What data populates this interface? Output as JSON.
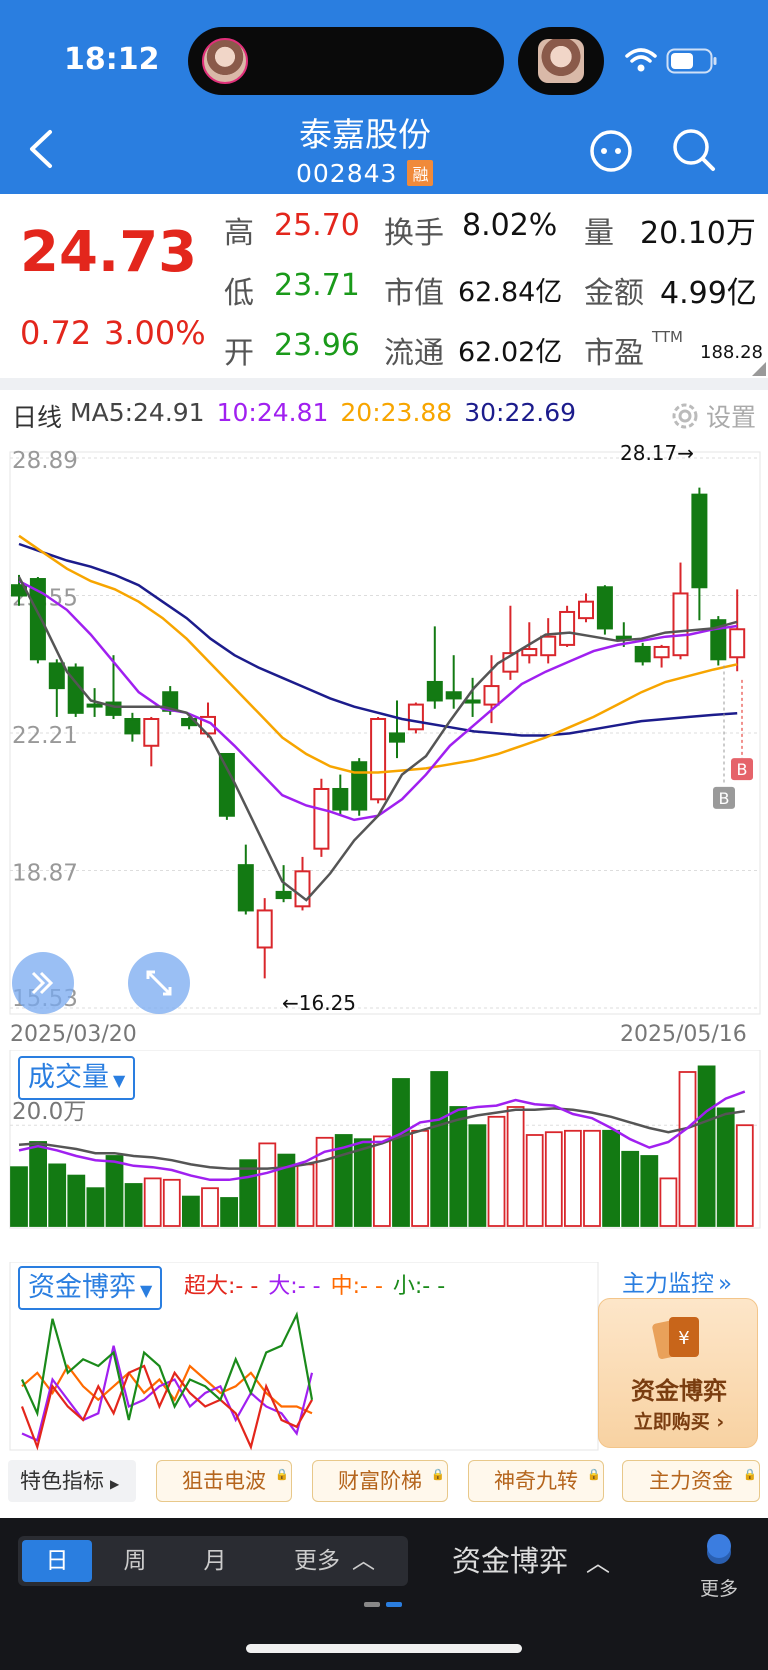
{
  "status_bar": {
    "time": "18:12"
  },
  "header": {
    "title": "泰嘉股份",
    "code": "002843",
    "badge": "融"
  },
  "quote": {
    "price": "24.73",
    "change": "0.72",
    "change_pct": "3.00%",
    "high_label": "高",
    "high": "25.70",
    "low_label": "低",
    "low": "23.71",
    "open_label": "开",
    "open": "23.96",
    "turnover_label": "换手",
    "turnover": "8.02%",
    "mktcap_label": "市值",
    "mktcap": "62.84亿",
    "float_label": "流通",
    "float": "62.02亿",
    "volume_label": "量",
    "volume": "20.10万",
    "amount_label": "金额",
    "amount": "4.99亿",
    "pe_label": "市盈",
    "pe_sup": "TTM",
    "pe": "188.28"
  },
  "chart_header": {
    "period": "日线",
    "ma5": "MA5:24.91",
    "ma10": "10:24.81",
    "ma20": "20:23.88",
    "ma30": "30:22.69",
    "settings": "设置",
    "colors": {
      "ma5": "#555555",
      "ma10": "#a020f0",
      "ma20": "#f7a500",
      "ma30": "#1c1c8c"
    }
  },
  "axis": {
    "y_labels": [
      "28.89",
      "25.55",
      "22.21",
      "18.87",
      "15.53"
    ],
    "date_start": "2025/03/20",
    "date_end": "2025/05/16",
    "high_marker": "28.17→",
    "low_marker": "←16.25",
    "buy_marker": "B"
  },
  "chart_data": {
    "type": "candlestick",
    "ylim": [
      15.53,
      28.89
    ],
    "candles": [
      {
        "o": 25.55,
        "c": 25.8,
        "h": 26.05,
        "l": 25.3,
        "up": false
      },
      {
        "o": 25.95,
        "c": 24.0,
        "h": 26.0,
        "l": 23.9,
        "up": false
      },
      {
        "o": 23.9,
        "c": 23.3,
        "h": 24.0,
        "l": 22.6,
        "up": false
      },
      {
        "o": 23.8,
        "c": 22.7,
        "h": 23.9,
        "l": 22.6,
        "up": false
      },
      {
        "o": 22.9,
        "c": 22.9,
        "h": 23.3,
        "l": 22.6,
        "up": false
      },
      {
        "o": 22.95,
        "c": 22.65,
        "h": 24.1,
        "l": 22.55,
        "up": false
      },
      {
        "o": 22.55,
        "c": 22.2,
        "h": 22.7,
        "l": 22.0,
        "up": false
      },
      {
        "o": 21.9,
        "c": 22.55,
        "h": 22.6,
        "l": 21.4,
        "up": true
      },
      {
        "o": 23.2,
        "c": 22.75,
        "h": 23.35,
        "l": 22.65,
        "up": false
      },
      {
        "o": 22.55,
        "c": 22.4,
        "h": 22.6,
        "l": 22.3,
        "up": false
      },
      {
        "o": 22.2,
        "c": 22.6,
        "h": 22.95,
        "l": 22.1,
        "up": true
      },
      {
        "o": 21.7,
        "c": 20.2,
        "h": 21.7,
        "l": 20.1,
        "up": false
      },
      {
        "o": 19.0,
        "c": 17.9,
        "h": 19.5,
        "l": 17.8,
        "up": false
      },
      {
        "o": 17.0,
        "c": 17.9,
        "h": 18.2,
        "l": 16.25,
        "up": true
      },
      {
        "o": 18.35,
        "c": 18.2,
        "h": 19.0,
        "l": 18.1,
        "up": false
      },
      {
        "o": 18.0,
        "c": 18.85,
        "h": 19.2,
        "l": 17.9,
        "up": true
      },
      {
        "o": 19.4,
        "c": 20.85,
        "h": 21.1,
        "l": 19.2,
        "up": true
      },
      {
        "o": 20.85,
        "c": 20.35,
        "h": 21.2,
        "l": 20.2,
        "up": false
      },
      {
        "o": 20.35,
        "c": 21.5,
        "h": 21.6,
        "l": 20.2,
        "up": false
      },
      {
        "o": 20.6,
        "c": 22.55,
        "h": 22.6,
        "l": 20.5,
        "up": true
      },
      {
        "o": 22.2,
        "c": 22.0,
        "h": 23.0,
        "l": 21.6,
        "up": false
      },
      {
        "o": 22.3,
        "c": 22.9,
        "h": 22.95,
        "l": 22.2,
        "up": true
      },
      {
        "o": 23.45,
        "c": 23.0,
        "h": 24.8,
        "l": 22.8,
        "up": false
      },
      {
        "o": 23.05,
        "c": 23.2,
        "h": 24.1,
        "l": 22.8,
        "up": false
      },
      {
        "o": 23.0,
        "c": 22.95,
        "h": 23.55,
        "l": 22.6,
        "up": false
      },
      {
        "o": 22.9,
        "c": 23.35,
        "h": 24.1,
        "l": 22.45,
        "up": true
      },
      {
        "o": 23.7,
        "c": 24.15,
        "h": 25.3,
        "l": 23.5,
        "up": true
      },
      {
        "o": 24.1,
        "c": 24.25,
        "h": 24.9,
        "l": 23.9,
        "up": true
      },
      {
        "o": 24.1,
        "c": 24.55,
        "h": 25.0,
        "l": 23.9,
        "up": true
      },
      {
        "o": 24.35,
        "c": 25.15,
        "h": 25.3,
        "l": 24.3,
        "up": true
      },
      {
        "o": 25.0,
        "c": 25.4,
        "h": 25.6,
        "l": 24.9,
        "up": true
      },
      {
        "o": 25.75,
        "c": 24.75,
        "h": 25.8,
        "l": 24.6,
        "up": false
      },
      {
        "o": 24.5,
        "c": 24.55,
        "h": 24.9,
        "l": 24.3,
        "up": false
      },
      {
        "o": 24.3,
        "c": 23.95,
        "h": 24.4,
        "l": 23.85,
        "up": false
      },
      {
        "o": 24.05,
        "c": 24.3,
        "h": 24.35,
        "l": 23.8,
        "up": true
      },
      {
        "o": 24.1,
        "c": 25.6,
        "h": 26.35,
        "l": 24.0,
        "up": true
      },
      {
        "o": 28.0,
        "c": 25.75,
        "h": 28.17,
        "l": 24.95,
        "up": false
      },
      {
        "o": 24.95,
        "c": 24.0,
        "h": 25.05,
        "l": 23.85,
        "up": false
      },
      {
        "o": 24.05,
        "c": 24.73,
        "h": 25.7,
        "l": 23.71,
        "up": true
      }
    ],
    "ma5": [
      26.0,
      24.9,
      23.7,
      23.0,
      22.85,
      22.85,
      22.85,
      22.7,
      22.1,
      21.0,
      19.8,
      18.6,
      18.15,
      18.8,
      19.6,
      20.2,
      21.2,
      21.65,
      22.5,
      23.3,
      23.9,
      24.25,
      24.6,
      24.65,
      24.55,
      24.45,
      24.5,
      24.65,
      24.7,
      24.75,
      24.91
    ],
    "ma10": [
      25.9,
      25.6,
      25.2,
      24.6,
      23.9,
      23.2,
      22.8,
      22.7,
      22.45,
      21.9,
      21.3,
      20.7,
      20.45,
      20.3,
      20.1,
      20.2,
      20.6,
      21.2,
      21.9,
      22.4,
      22.9,
      23.4,
      23.7,
      23.95,
      24.2,
      24.35,
      24.45,
      24.55,
      24.6,
      24.73,
      24.81
    ],
    "ma20": [
      27.0,
      26.6,
      26.2,
      25.9,
      25.7,
      25.4,
      25.0,
      24.5,
      23.9,
      23.3,
      22.7,
      22.1,
      21.7,
      21.4,
      21.25,
      21.25,
      21.3,
      21.35,
      21.45,
      21.55,
      21.7,
      21.9,
      22.1,
      22.35,
      22.6,
      22.9,
      23.2,
      23.45,
      23.6,
      23.75,
      23.88
    ],
    "ma30": [
      26.8,
      26.6,
      26.4,
      26.25,
      26.05,
      25.8,
      25.4,
      25.0,
      24.5,
      24.1,
      23.8,
      23.55,
      23.3,
      23.05,
      22.85,
      22.7,
      22.55,
      22.45,
      22.35,
      22.25,
      22.2,
      22.15,
      22.15,
      22.2,
      22.3,
      22.4,
      22.5,
      22.55,
      22.6,
      22.65,
      22.69
    ]
  },
  "volume": {
    "button": "成交量",
    "label": "20.0万",
    "bars": [
      {
        "v": 0.42,
        "up": false
      },
      {
        "v": 0.6,
        "up": false
      },
      {
        "v": 0.44,
        "up": false
      },
      {
        "v": 0.36,
        "up": false
      },
      {
        "v": 0.27,
        "up": false
      },
      {
        "v": 0.5,
        "up": false
      },
      {
        "v": 0.3,
        "up": false
      },
      {
        "v": 0.34,
        "up": true
      },
      {
        "v": 0.33,
        "up": true
      },
      {
        "v": 0.21,
        "up": false
      },
      {
        "v": 0.27,
        "up": true
      },
      {
        "v": 0.2,
        "up": false
      },
      {
        "v": 0.47,
        "up": false
      },
      {
        "v": 0.59,
        "up": true
      },
      {
        "v": 0.51,
        "up": false
      },
      {
        "v": 0.44,
        "up": true
      },
      {
        "v": 0.63,
        "up": true
      },
      {
        "v": 0.65,
        "up": false
      },
      {
        "v": 0.62,
        "up": false
      },
      {
        "v": 0.64,
        "up": true
      },
      {
        "v": 1.05,
        "up": false
      },
      {
        "v": 0.68,
        "up": true
      },
      {
        "v": 1.1,
        "up": false
      },
      {
        "v": 0.85,
        "up": false
      },
      {
        "v": 0.72,
        "up": false
      },
      {
        "v": 0.78,
        "up": true
      },
      {
        "v": 0.85,
        "up": true
      },
      {
        "v": 0.65,
        "up": true
      },
      {
        "v": 0.67,
        "up": true
      },
      {
        "v": 0.68,
        "up": true
      },
      {
        "v": 0.68,
        "up": true
      },
      {
        "v": 0.68,
        "up": false
      },
      {
        "v": 0.53,
        "up": false
      },
      {
        "v": 0.5,
        "up": false
      },
      {
        "v": 0.34,
        "up": true
      },
      {
        "v": 1.1,
        "up": true
      },
      {
        "v": 1.14,
        "up": false
      },
      {
        "v": 0.84,
        "up": false
      },
      {
        "v": 0.72,
        "up": true
      }
    ],
    "ma1": [
      0.54,
      0.57,
      0.54,
      0.5,
      0.47,
      0.46,
      0.43,
      0.42,
      0.4,
      0.36,
      0.33,
      0.33,
      0.35,
      0.38,
      0.42,
      0.46,
      0.53,
      0.56,
      0.6,
      0.6,
      0.66,
      0.74,
      0.76,
      0.83,
      0.85,
      0.86,
      0.9,
      0.87,
      0.86,
      0.8,
      0.77,
      0.7,
      0.62,
      0.56,
      0.6,
      0.7,
      0.82,
      0.91,
      0.96
    ],
    "ma2": [
      0.58,
      0.59,
      0.57,
      0.55,
      0.52,
      0.52,
      0.5,
      0.49,
      0.47,
      0.44,
      0.42,
      0.41,
      0.41,
      0.41,
      0.42,
      0.44,
      0.47,
      0.51,
      0.55,
      0.59,
      0.64,
      0.68,
      0.72,
      0.76,
      0.79,
      0.81,
      0.83,
      0.83,
      0.84,
      0.83,
      0.81,
      0.78,
      0.74,
      0.7,
      0.67,
      0.7,
      0.75,
      0.8,
      0.82
    ]
  },
  "capital": {
    "button": "资金博弈",
    "legend": {
      "super": "超大:- -",
      "large": "大:- -",
      "medium": "中:- -",
      "small": "小:- -"
    },
    "monitor": "主力监控",
    "promo_title": "资金博弈",
    "promo_sub": "立即购买",
    "lines": {
      "green": [
        0.5,
        0.25,
        0.95,
        0.55,
        0.65,
        0.6,
        0.7,
        0.2,
        0.7,
        0.6,
        0.3,
        0.5,
        0.45,
        0.35,
        0.65,
        0.4,
        0.7,
        0.75,
        0.98,
        0.35
      ],
      "red": [
        0.3,
        0.0,
        0.45,
        0.3,
        0.2,
        0.45,
        0.25,
        0.55,
        0.6,
        0.3,
        0.55,
        0.4,
        0.3,
        0.35,
        0.25,
        0.0,
        0.45,
        0.2,
        0.15,
        0.35
      ],
      "purple": [
        0.1,
        0.05,
        0.5,
        0.35,
        0.2,
        0.25,
        0.75,
        0.3,
        0.35,
        0.45,
        0.5,
        0.3,
        0.4,
        0.45,
        0.2,
        0.4,
        0.3,
        0.25,
        0.1,
        0.55
      ],
      "orange": [
        0.45,
        0.55,
        0.4,
        0.6,
        0.45,
        0.35,
        0.45,
        0.55,
        0.4,
        0.5,
        0.35,
        0.6,
        0.5,
        0.4,
        0.45,
        0.55,
        0.4,
        0.3,
        0.3,
        0.25
      ]
    },
    "colors": {
      "super": "#e3261c",
      "large": "#a020f0",
      "medium": "#ff6a00",
      "small": "#1a8a1a"
    }
  },
  "indicator_bar": {
    "label": "特色指标",
    "tags": [
      "狙击电波",
      "财富阶梯",
      "神奇九转",
      "主力资金"
    ]
  },
  "bottom_bar": {
    "tabs": [
      "日",
      "周",
      "月"
    ],
    "more": "更多",
    "capital": "资金博弈",
    "menu_more": "更多"
  }
}
